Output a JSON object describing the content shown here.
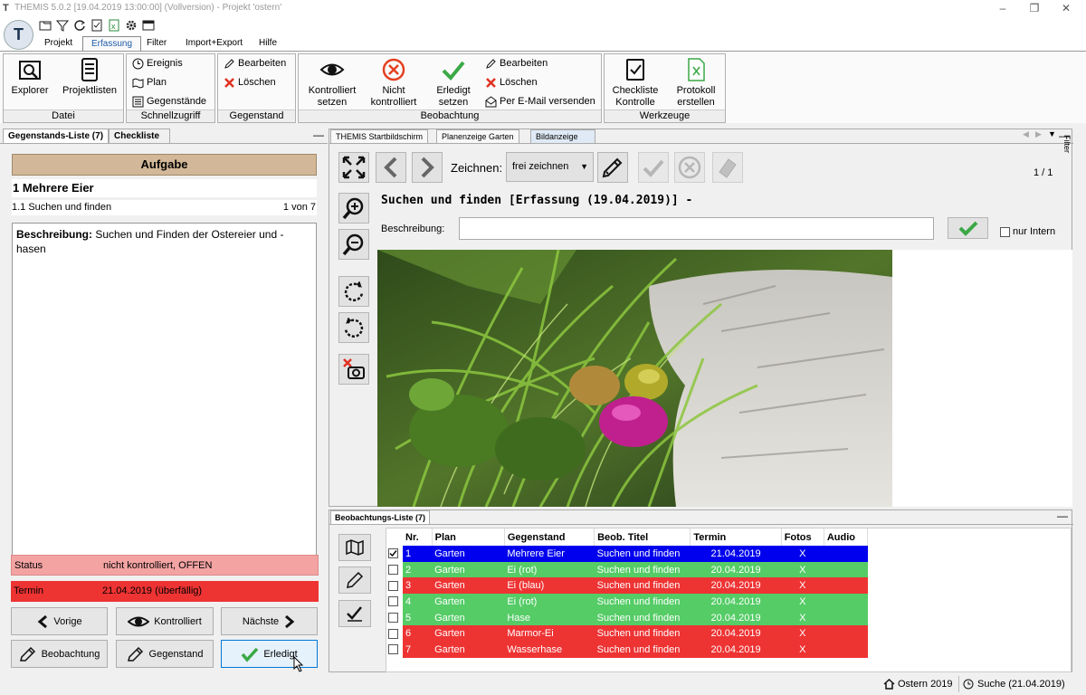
{
  "titlebar": {
    "app_name": "THEMIS 5.0.2",
    "info": "[19.04.2019 13:00:00]  (Vollversion) - Projekt 'ostern'"
  },
  "ribbon_tabs": [
    "Projekt",
    "Erfassung",
    "Filter",
    "Import+Export",
    "Hilfe"
  ],
  "ribbon": {
    "datei": {
      "label": "Datei",
      "explorer": "Explorer",
      "projektlisten": "Projektlisten"
    },
    "schnellzugriff": {
      "label": "Schnellzugriff",
      "ereignis": "Ereignis",
      "plan": "Plan",
      "gegenstaende": "Gegenstände"
    },
    "gegenstand": {
      "label": "Gegenstand",
      "bearbeiten": "Bearbeiten",
      "loeschen": "Löschen"
    },
    "beobachtung": {
      "label": "Beobachtung",
      "kontrolliert_1": "Kontrolliert",
      "kontrolliert_2": "setzen",
      "nicht_1": "Nicht",
      "nicht_2": "kontrolliert",
      "erledigt_1": "Erledigt",
      "erledigt_2": "setzen",
      "bearbeiten": "Bearbeiten",
      "loeschen": "Löschen",
      "email": "Per E-Mail versenden"
    },
    "werkzeuge": {
      "label": "Werkzeuge",
      "checkliste_1": "Checkliste",
      "checkliste_2": "Kontrolle",
      "protokoll_1": "Protokoll",
      "protokoll_2": "erstellen"
    }
  },
  "left_panel": {
    "tabs": [
      "Gegenstands-Liste (7)",
      "Checkliste"
    ],
    "aufgabe_header": "Aufgabe",
    "item_title": "1  Mehrere Eier",
    "sub_item": "1.1  Suchen und finden",
    "sub_count": "1 von 7",
    "description_label": "Beschreibung:",
    "description_text": "Suchen und Finden der Ostereier und -hasen",
    "status_label": "Status",
    "status_value": "nicht kontrolliert, OFFEN",
    "termin_label": "Termin",
    "termin_value": "21.04.2019 (überfällig)",
    "buttons": {
      "vorige": "Vorige",
      "kontrolliert": "Kontrolliert",
      "naechste": "Nächste",
      "beobachtung": "Beobachtung",
      "gegenstand": "Gegenstand",
      "erledigt": "Erledigt"
    }
  },
  "right_panel": {
    "tabs": [
      "THEMIS Startbildschirm",
      "Planenzeige Garten",
      "Bildanzeige"
    ],
    "filter_label": "Filter",
    "zeichnen_label": "Zeichnen:",
    "zeichnen_value": "frei zeichnen",
    "page_count": "1 / 1",
    "image_title": "Suchen und finden [Erfassung (19.04.2019)] -",
    "beschreibung_label": "Beschreibung:",
    "beschreibung_value": "",
    "nur_intern": "nur Intern"
  },
  "obs_list": {
    "title": "Beobachtungs-Liste (7)",
    "columns": [
      "Nr.",
      "Plan",
      "Gegenstand",
      "Beob. Titel",
      "Termin",
      "Fotos",
      "Audio"
    ],
    "rows": [
      {
        "nr": "1",
        "plan": "Garten",
        "gegenstand": "Mehrere Eier",
        "titel": "Suchen und finden",
        "termin": "21.04.2019",
        "fotos": "X",
        "audio": "",
        "status": "sel",
        "checked": true
      },
      {
        "nr": "2",
        "plan": "Garten",
        "gegenstand": "Ei (rot)",
        "titel": "Suchen und finden",
        "termin": "20.04.2019",
        "fotos": "X",
        "audio": "",
        "status": "green",
        "checked": false
      },
      {
        "nr": "3",
        "plan": "Garten",
        "gegenstand": "Ei (blau)",
        "titel": "Suchen und finden",
        "termin": "20.04.2019",
        "fotos": "X",
        "audio": "",
        "status": "red",
        "checked": false
      },
      {
        "nr": "4",
        "plan": "Garten",
        "gegenstand": "Ei (rot)",
        "titel": "Suchen und finden",
        "termin": "20.04.2019",
        "fotos": "X",
        "audio": "",
        "status": "green",
        "checked": false
      },
      {
        "nr": "5",
        "plan": "Garten",
        "gegenstand": "Hase",
        "titel": "Suchen und finden",
        "termin": "20.04.2019",
        "fotos": "X",
        "audio": "",
        "status": "green",
        "checked": false
      },
      {
        "nr": "6",
        "plan": "Garten",
        "gegenstand": "Marmor-Ei",
        "titel": "Suchen und finden",
        "termin": "20.04.2019",
        "fotos": "X",
        "audio": "",
        "status": "red",
        "checked": false
      },
      {
        "nr": "7",
        "plan": "Garten",
        "gegenstand": "Wasserhase",
        "titel": "Suchen und finden",
        "termin": "20.04.2019",
        "fotos": "X",
        "audio": "",
        "status": "red",
        "checked": false
      }
    ]
  },
  "footer": {
    "project": "Ostern 2019",
    "search": "Suche (21.04.2019)"
  },
  "colors": {
    "red_row": "#ee3333",
    "green_row": "#55cc66",
    "selected_row": "#0000ee",
    "status_bg": "#f4a3a3",
    "termin_bg": "#ee3333",
    "aufgabe_bg": "#d2b898"
  }
}
